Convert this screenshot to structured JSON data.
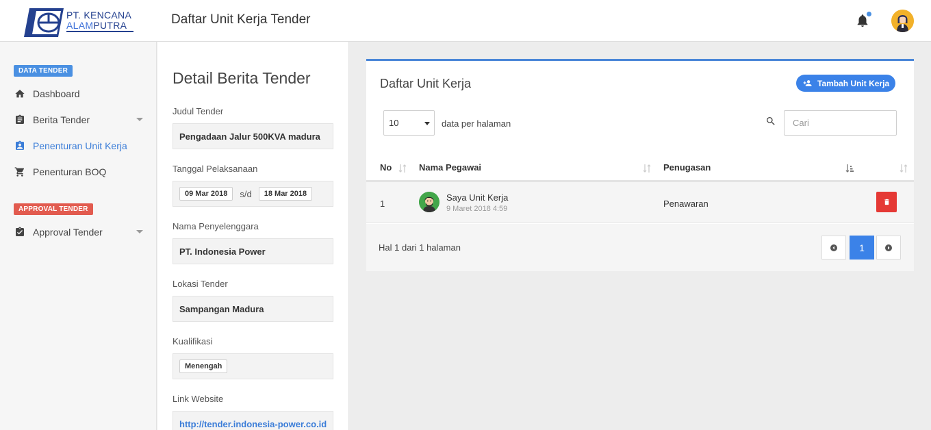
{
  "header": {
    "logo_line1": "PT. KENCANA",
    "logo_line2_a": "ALAM",
    "logo_line2_b": "PUTRA",
    "title": "Daftar Unit Kerja Tender",
    "notification_icon": "bell-icon",
    "has_notification": true
  },
  "sidebar": {
    "section1_label": "DATA TENDER",
    "section1_color": "#4a90e2",
    "section2_label": "APPROVAL TENDER",
    "section2_color": "#e25b4f",
    "items": [
      {
        "label": "Dashboard",
        "icon": "home-icon",
        "active": false
      },
      {
        "label": "Berita Tender",
        "icon": "clipboard-icon",
        "active": false,
        "expandable": true
      },
      {
        "label": "Penenturan Unit Kerja",
        "icon": "assignment-ind-icon",
        "active": true
      },
      {
        "label": "Penenturan BOQ",
        "icon": "cart-icon",
        "active": false
      },
      {
        "label": "Approval Tender",
        "icon": "assignment-check-icon",
        "active": false,
        "expandable": true
      }
    ],
    "active_color": "#3b7dd8"
  },
  "detail": {
    "heading": "Detail Berita Tender",
    "judul_label": "Judul Tender",
    "judul_value": "Pengadaan Jalur 500KVA madura",
    "tanggal_label": "Tanggal Pelaksanaan",
    "tanggal_start": "09 Mar 2018",
    "tanggal_sep": "s/d",
    "tanggal_end": "18 Mar 2018",
    "penyelenggara_label": "Nama Penyelenggara",
    "penyelenggara_value": "PT. Indonesia Power",
    "lokasi_label": "Lokasi Tender",
    "lokasi_value": "Sampangan Madura",
    "kualifikasi_label": "Kualifikasi",
    "kualifikasi_value": "Menengah",
    "website_label": "Link Website",
    "website_value": "http://tender.indonesia-power.co.id"
  },
  "card": {
    "title": "Daftar Unit Kerja",
    "add_button": "Tambah Unit Kerja",
    "per_page_value": "10",
    "per_page_label": "data per halaman",
    "search_placeholder": "Cari",
    "columns": {
      "no": "No",
      "nama": "Nama Pegawai",
      "penugasan": "Penugasan"
    },
    "rows": [
      {
        "no": "1",
        "name": "Saya Unit Kerja",
        "date": "9 Maret 2018 4:59",
        "task": "Penawaran"
      }
    ],
    "page_info": "Hal 1 dari 1 halaman",
    "current_page": "1",
    "accent_color": "#3b82e8",
    "delete_color": "#e53935"
  }
}
